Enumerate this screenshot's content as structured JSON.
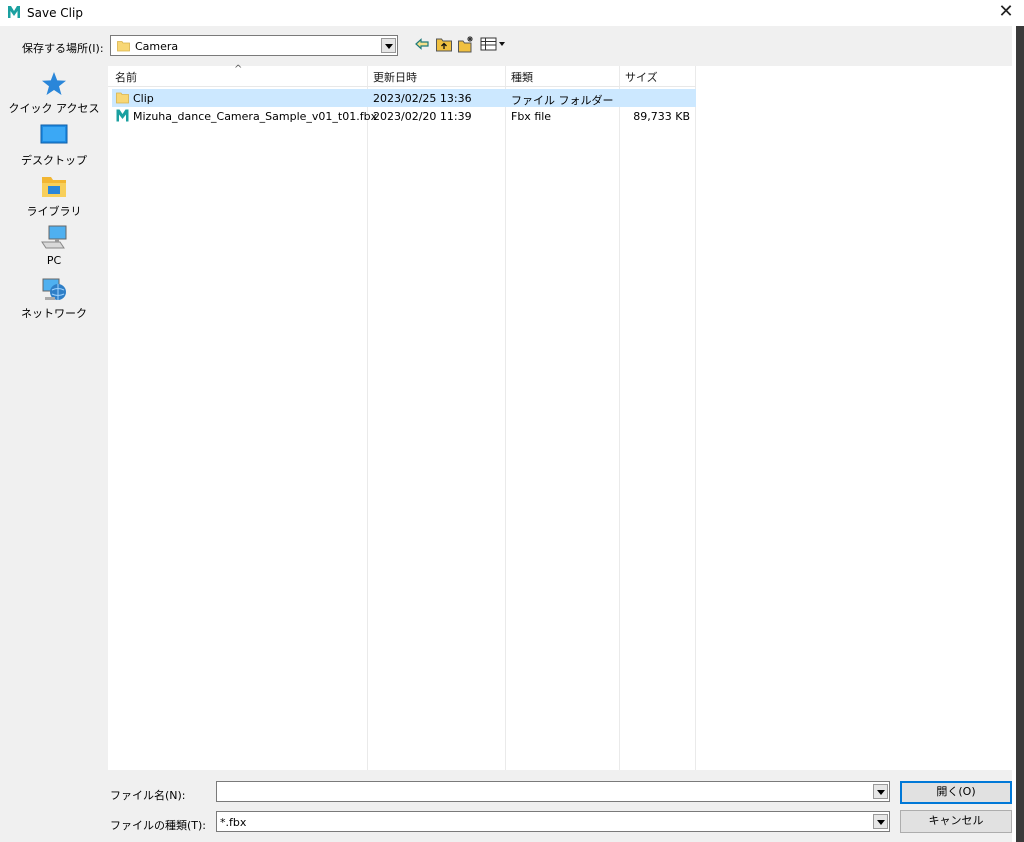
{
  "window": {
    "title": "Save Clip",
    "close": "✕"
  },
  "location": {
    "label": "保存する場所(I):",
    "value": "Camera"
  },
  "places": [
    {
      "label": "クイック アクセス",
      "icon": "star-icon"
    },
    {
      "label": "デスクトップ",
      "icon": "desktop-icon"
    },
    {
      "label": "ライブラリ",
      "icon": "library-icon"
    },
    {
      "label": "PC",
      "icon": "computer-icon"
    },
    {
      "label": "ネットワーク",
      "icon": "network-icon"
    }
  ],
  "columns": {
    "name": "名前",
    "date": "更新日時",
    "type": "種類",
    "size": "サイズ",
    "sort_caret": "^"
  },
  "files": [
    {
      "name": "Clip",
      "date": "2023/02/25 13:36",
      "type": "ファイル フォルダー",
      "size": "",
      "icon": "folder-icon",
      "selected": true
    },
    {
      "name": "Mizuha_dance_Camera_Sample_v01_t01.fbx",
      "date": "2023/02/20 11:39",
      "type": "Fbx file",
      "size": "89,733 KB",
      "icon": "maya-file-icon",
      "selected": false
    }
  ],
  "bottom": {
    "filename_label": "ファイル名(N):",
    "filename_value": "",
    "filetype_label": "ファイルの種類(T):",
    "filetype_value": "*.fbx",
    "open_button": "開く(O)",
    "cancel_button": "キャンセル"
  },
  "colors": {
    "accent": "#0078d7",
    "selection": "#cce8ff",
    "maya_teal": "#1ba0a0",
    "folder": "#f8d775"
  }
}
